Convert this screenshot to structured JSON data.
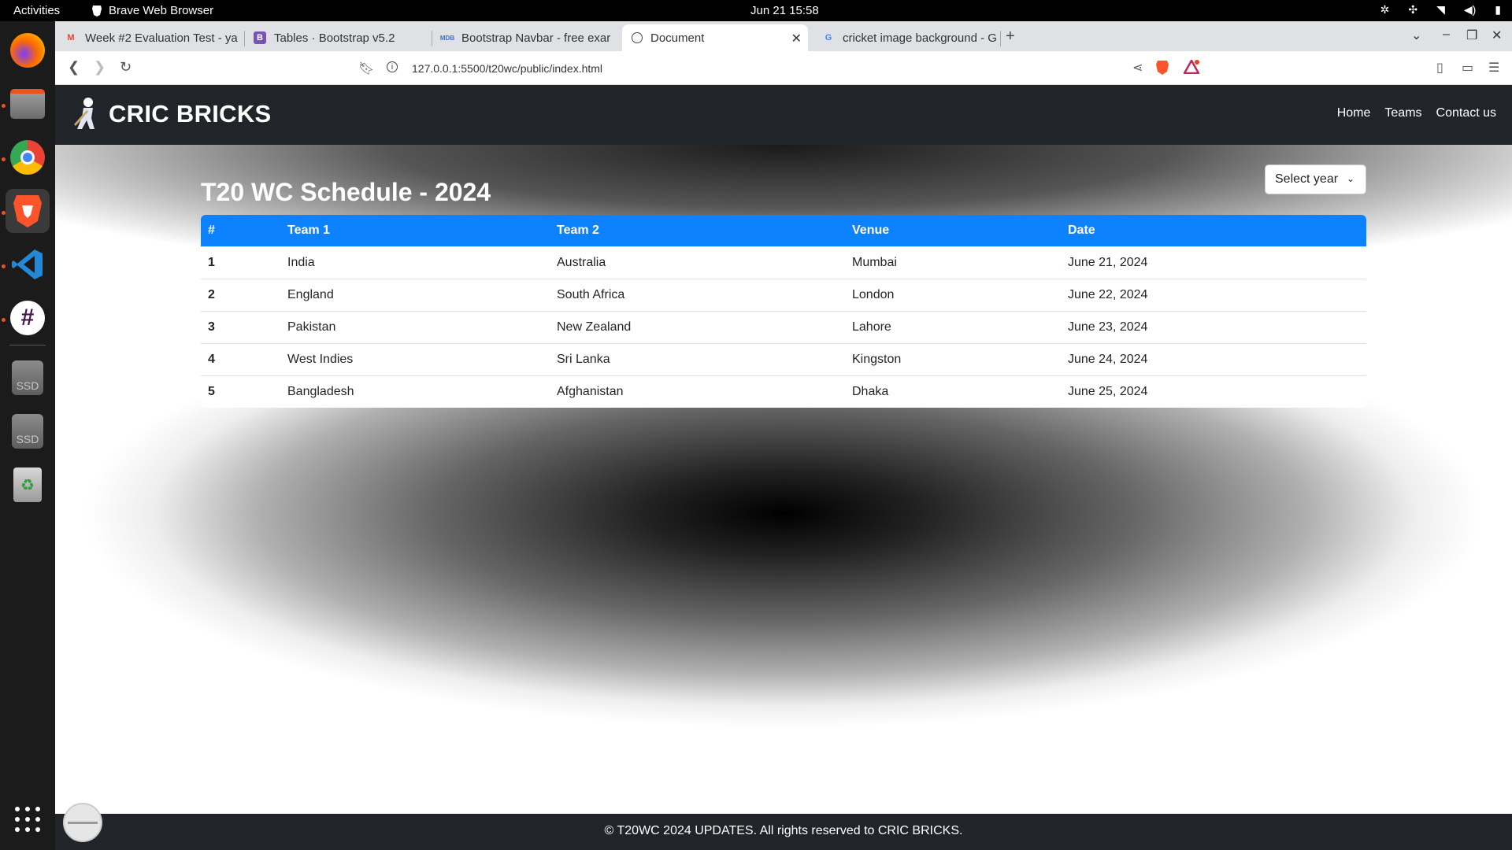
{
  "system": {
    "activities": "Activities",
    "app_name": "Brave Web Browser",
    "clock": "Jun 21  15:58"
  },
  "browser": {
    "tabs": [
      {
        "label": "Week #2 Evaluation Test - ya",
        "favicon": "gmail-icon",
        "active": false
      },
      {
        "label": "Tables · Bootstrap v5.2",
        "favicon": "bootstrap-icon",
        "active": false
      },
      {
        "label": "Bootstrap Navbar - free exar",
        "favicon": "mdb-icon",
        "active": false
      },
      {
        "label": "Document",
        "favicon": "globe-icon",
        "active": true
      },
      {
        "label": "cricket image background - G",
        "favicon": "google-icon",
        "active": false
      }
    ],
    "url": "127.0.0.1:5500/t20wc/public/index.html",
    "accent": "#fb542b"
  },
  "site": {
    "brand": "CRIC BRICKS",
    "nav": [
      {
        "label": "Home"
      },
      {
        "label": "Teams"
      },
      {
        "label": "Contact us"
      }
    ],
    "title": "T20 WC Schedule - 2024",
    "year_select": "Select year",
    "table": {
      "headers": [
        "#",
        "Team 1",
        "Team 2",
        "Venue",
        "Date"
      ],
      "header_color": "#0d82ff",
      "rows": [
        [
          "1",
          "India",
          "Australia",
          "Mumbai",
          "June 21, 2024"
        ],
        [
          "2",
          "England",
          "South Africa",
          "London",
          "June 22, 2024"
        ],
        [
          "3",
          "Pakistan",
          "New Zealand",
          "Lahore",
          "June 23, 2024"
        ],
        [
          "4",
          "West Indies",
          "Sri Lanka",
          "Kingston",
          "June 24, 2024"
        ],
        [
          "5",
          "Bangladesh",
          "Afghanistan",
          "Dhaka",
          "June 25, 2024"
        ]
      ]
    },
    "footer": "© T20WC 2024 UPDATES. All rights reserved to CRIC BRICKS."
  }
}
